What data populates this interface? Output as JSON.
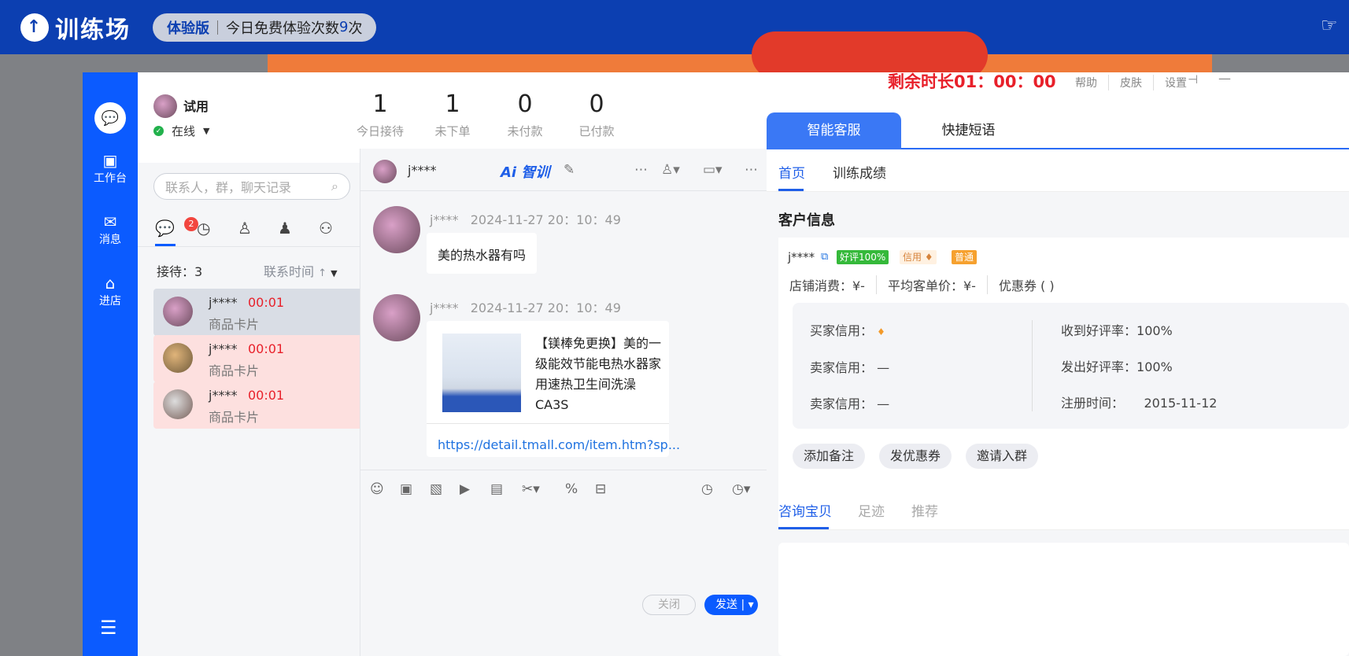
{
  "topbar": {
    "brand": "训练场",
    "trial_tag": "体验版",
    "trial_text_prefix": "今日免费体验次数",
    "trial_count": "9",
    "trial_text_suffix": "次"
  },
  "rail": {
    "items": [
      {
        "label": "工作台",
        "icon": "workbench-icon"
      },
      {
        "label": "消息",
        "icon": "message-icon"
      },
      {
        "label": "进店",
        "icon": "store-icon"
      }
    ]
  },
  "profile": {
    "name": "试用",
    "status": "在线"
  },
  "stats": [
    {
      "value": "1",
      "label": "今日接待"
    },
    {
      "value": "1",
      "label": "未下单"
    },
    {
      "value": "0",
      "label": "未付款"
    },
    {
      "value": "0",
      "label": "已付款"
    }
  ],
  "search": {
    "placeholder": "联系人，群，聊天记录"
  },
  "tabs": {
    "badge": "2"
  },
  "list": {
    "receiving": "接待：3",
    "sort": "联系时间"
  },
  "conversations": [
    {
      "name": "j****",
      "time": "00:01",
      "sub": "商品卡片",
      "bg": "#d9dde5"
    },
    {
      "name": "j****",
      "time": "00:01",
      "sub": "商品卡片",
      "bg": "#fde0df"
    },
    {
      "name": "j****",
      "time": "00:01",
      "sub": "商品卡片",
      "bg": "#fde0df"
    }
  ],
  "chat": {
    "header_name": "j****",
    "ai_label": "Ai 智训",
    "messages": [
      {
        "name": "j****",
        "time": "2024-11-27 20：10：49",
        "text": "美的热水器有吗"
      },
      {
        "name": "j****",
        "time": "2024-11-27 20：10：49"
      }
    ],
    "card": {
      "title": "【镁棒免更换】美的一级能效节能电热水器家用速热卫生间洗澡CA3S",
      "link": "https://detail.tmall.com/item.htm?sp..."
    },
    "close_label": "关闭",
    "send_label": "发送"
  },
  "right": {
    "timer": "剩余时长01：00：00",
    "links": [
      "帮助",
      "皮肤",
      "设置"
    ],
    "tab_active": "智能客服",
    "tab_other": "快捷短语",
    "sub_tabs": [
      "首页",
      "训练成绩"
    ],
    "section_title": "客户信息",
    "customer": {
      "name": "j****",
      "tag_good": "好评100%",
      "tag_credit": "信用",
      "tag_normal": "普通",
      "shop_spend": "店铺消费：¥-",
      "avg_price": "平均客单价：¥-",
      "coupon": "优惠券 ( )"
    },
    "credit": {
      "buyer_label": "买家信用：",
      "seller_label1": "卖家信用：",
      "seller_value1": "—",
      "seller_label2": "卖家信用：",
      "seller_value2": "—",
      "recv_good_label": "收到好评率：",
      "recv_good_value": "100%",
      "sent_good_label": "发出好评率：",
      "sent_good_value": "100%",
      "reg_label": "注册时间：",
      "reg_value": "2015-11-12"
    },
    "actions": [
      "添加备注",
      "发优惠券",
      "邀请入群"
    ],
    "bottom_tabs": [
      "咨询宝贝",
      "足迹",
      "推荐"
    ]
  }
}
